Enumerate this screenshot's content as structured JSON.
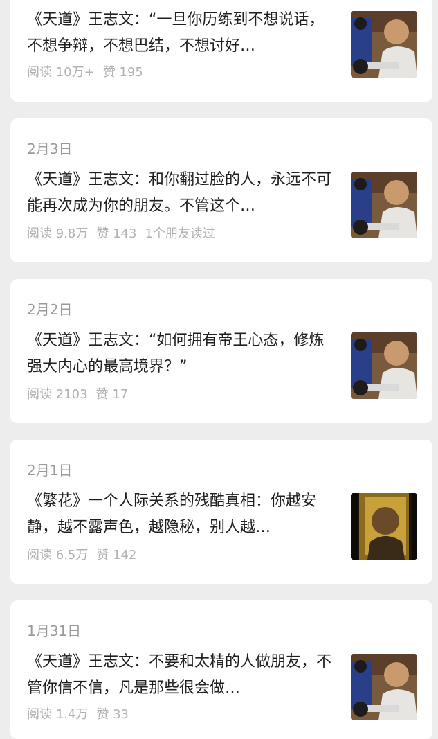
{
  "articles": [
    {
      "date": "",
      "title": "《天道》王志文：“一旦你历练到不想说话，不想争辩，不想巴结，不想讨好…",
      "reads": "阅读 10万+",
      "likes": "赞 195",
      "friends": "",
      "thumb_icon": "tiandao-still-image"
    },
    {
      "date": "2月3日",
      "title": "《天道》王志文：和你翻过脸的人，永远不可能再次成为你的朋友。不管这个…",
      "reads": "阅读 9.8万",
      "likes": "赞 143",
      "friends": "1个朋友读过",
      "thumb_icon": "tiandao-still-image"
    },
    {
      "date": "2月2日",
      "title": "《天道》王志文：“如何拥有帝王心态，修炼强大内心的最高境界？”",
      "reads": "阅读 2103",
      "likes": "赞 17",
      "friends": "",
      "thumb_icon": "tiandao-still-image"
    },
    {
      "date": "2月1日",
      "title": "《繁花》一个人际关系的残酷真相：你越安静，越不露声色，越隐秘，别人越…",
      "reads": "阅读 6.5万",
      "likes": "赞 142",
      "friends": "",
      "thumb_icon": "fanhua-still-image"
    },
    {
      "date": "1月31日",
      "title": "《天道》王志文：不要和太精的人做朋友，不管你信不信，凡是那些很会做…",
      "reads": "阅读 1.4万",
      "likes": "赞 33",
      "friends": "",
      "thumb_icon": "tiandao-still-image"
    }
  ]
}
